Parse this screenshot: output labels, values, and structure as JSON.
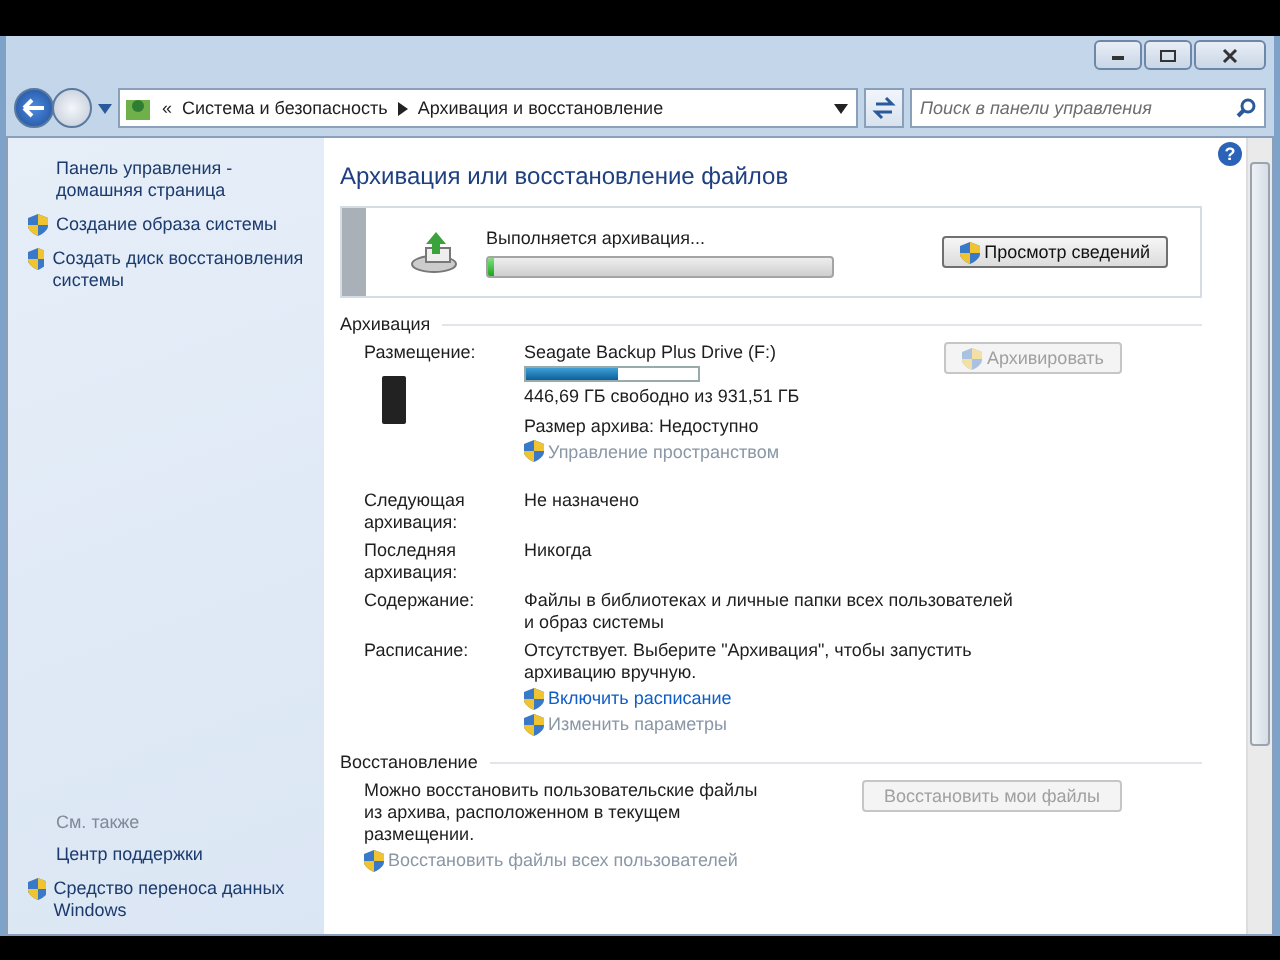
{
  "address_bar": {
    "overflow": "«",
    "breadcrumbs": [
      "Система и безопасность",
      "Архивация и восстановление"
    ]
  },
  "search": {
    "placeholder": "Поиск в панели управления"
  },
  "sidebar": {
    "items": [
      {
        "kind": "link",
        "label": "Панель управления - домашняя страница"
      },
      {
        "kind": "shield",
        "label": "Создание образа системы"
      },
      {
        "kind": "shield",
        "label": "Создать диск восстановления системы"
      }
    ],
    "see_also": {
      "heading": "См. также",
      "items": [
        {
          "kind": "link",
          "label": "Центр поддержки"
        },
        {
          "kind": "shield",
          "label": "Средство переноса данных Windows"
        }
      ]
    }
  },
  "main": {
    "help": "?",
    "title": "Архивация или восстановление файлов",
    "status": {
      "text": "Выполняется архивация...",
      "level": 0.02,
      "button": "Просмотр сведений"
    },
    "backup": {
      "heading": "Архивация",
      "location_label": "Размещение:",
      "drive_name": "Seagate Backup Plus Drive (F:)",
      "drive_usage": {
        "level": 0.54
      },
      "free_space": "446,69 ГБ свободно из 931,51 ГБ",
      "archive_size": "Размер архива: Недоступно",
      "manage_link": {
        "label": "Управление пространством",
        "disabled": true
      },
      "button": {
        "label": "Архивировать",
        "disabled": true
      },
      "details": [
        {
          "label": "Следующая архивация:",
          "value": "Не назначено"
        },
        {
          "label": "Последняя архивация:",
          "value": "Никогда"
        },
        {
          "label": "Содержание:",
          "value": "Файлы в библиотеках и личные папки всех пользователей и образ системы"
        },
        {
          "label": "Расписание:",
          "value": "Отсутствует. Выберите \"Архивация\", чтобы запустить архивацию вручную."
        }
      ],
      "schedule_links": [
        {
          "label": "Включить расписание",
          "disabled": false
        },
        {
          "label": "Изменить параметры",
          "disabled": true
        }
      ]
    },
    "restore": {
      "heading": "Восстановление",
      "text": "Можно восстановить пользовательские файлы из архива, расположенном в текущем размещении.",
      "button": {
        "label": "Восстановить мои файлы",
        "disabled": true
      },
      "link": {
        "label": "Восстановить файлы всех пользователей",
        "disabled": true
      }
    }
  }
}
